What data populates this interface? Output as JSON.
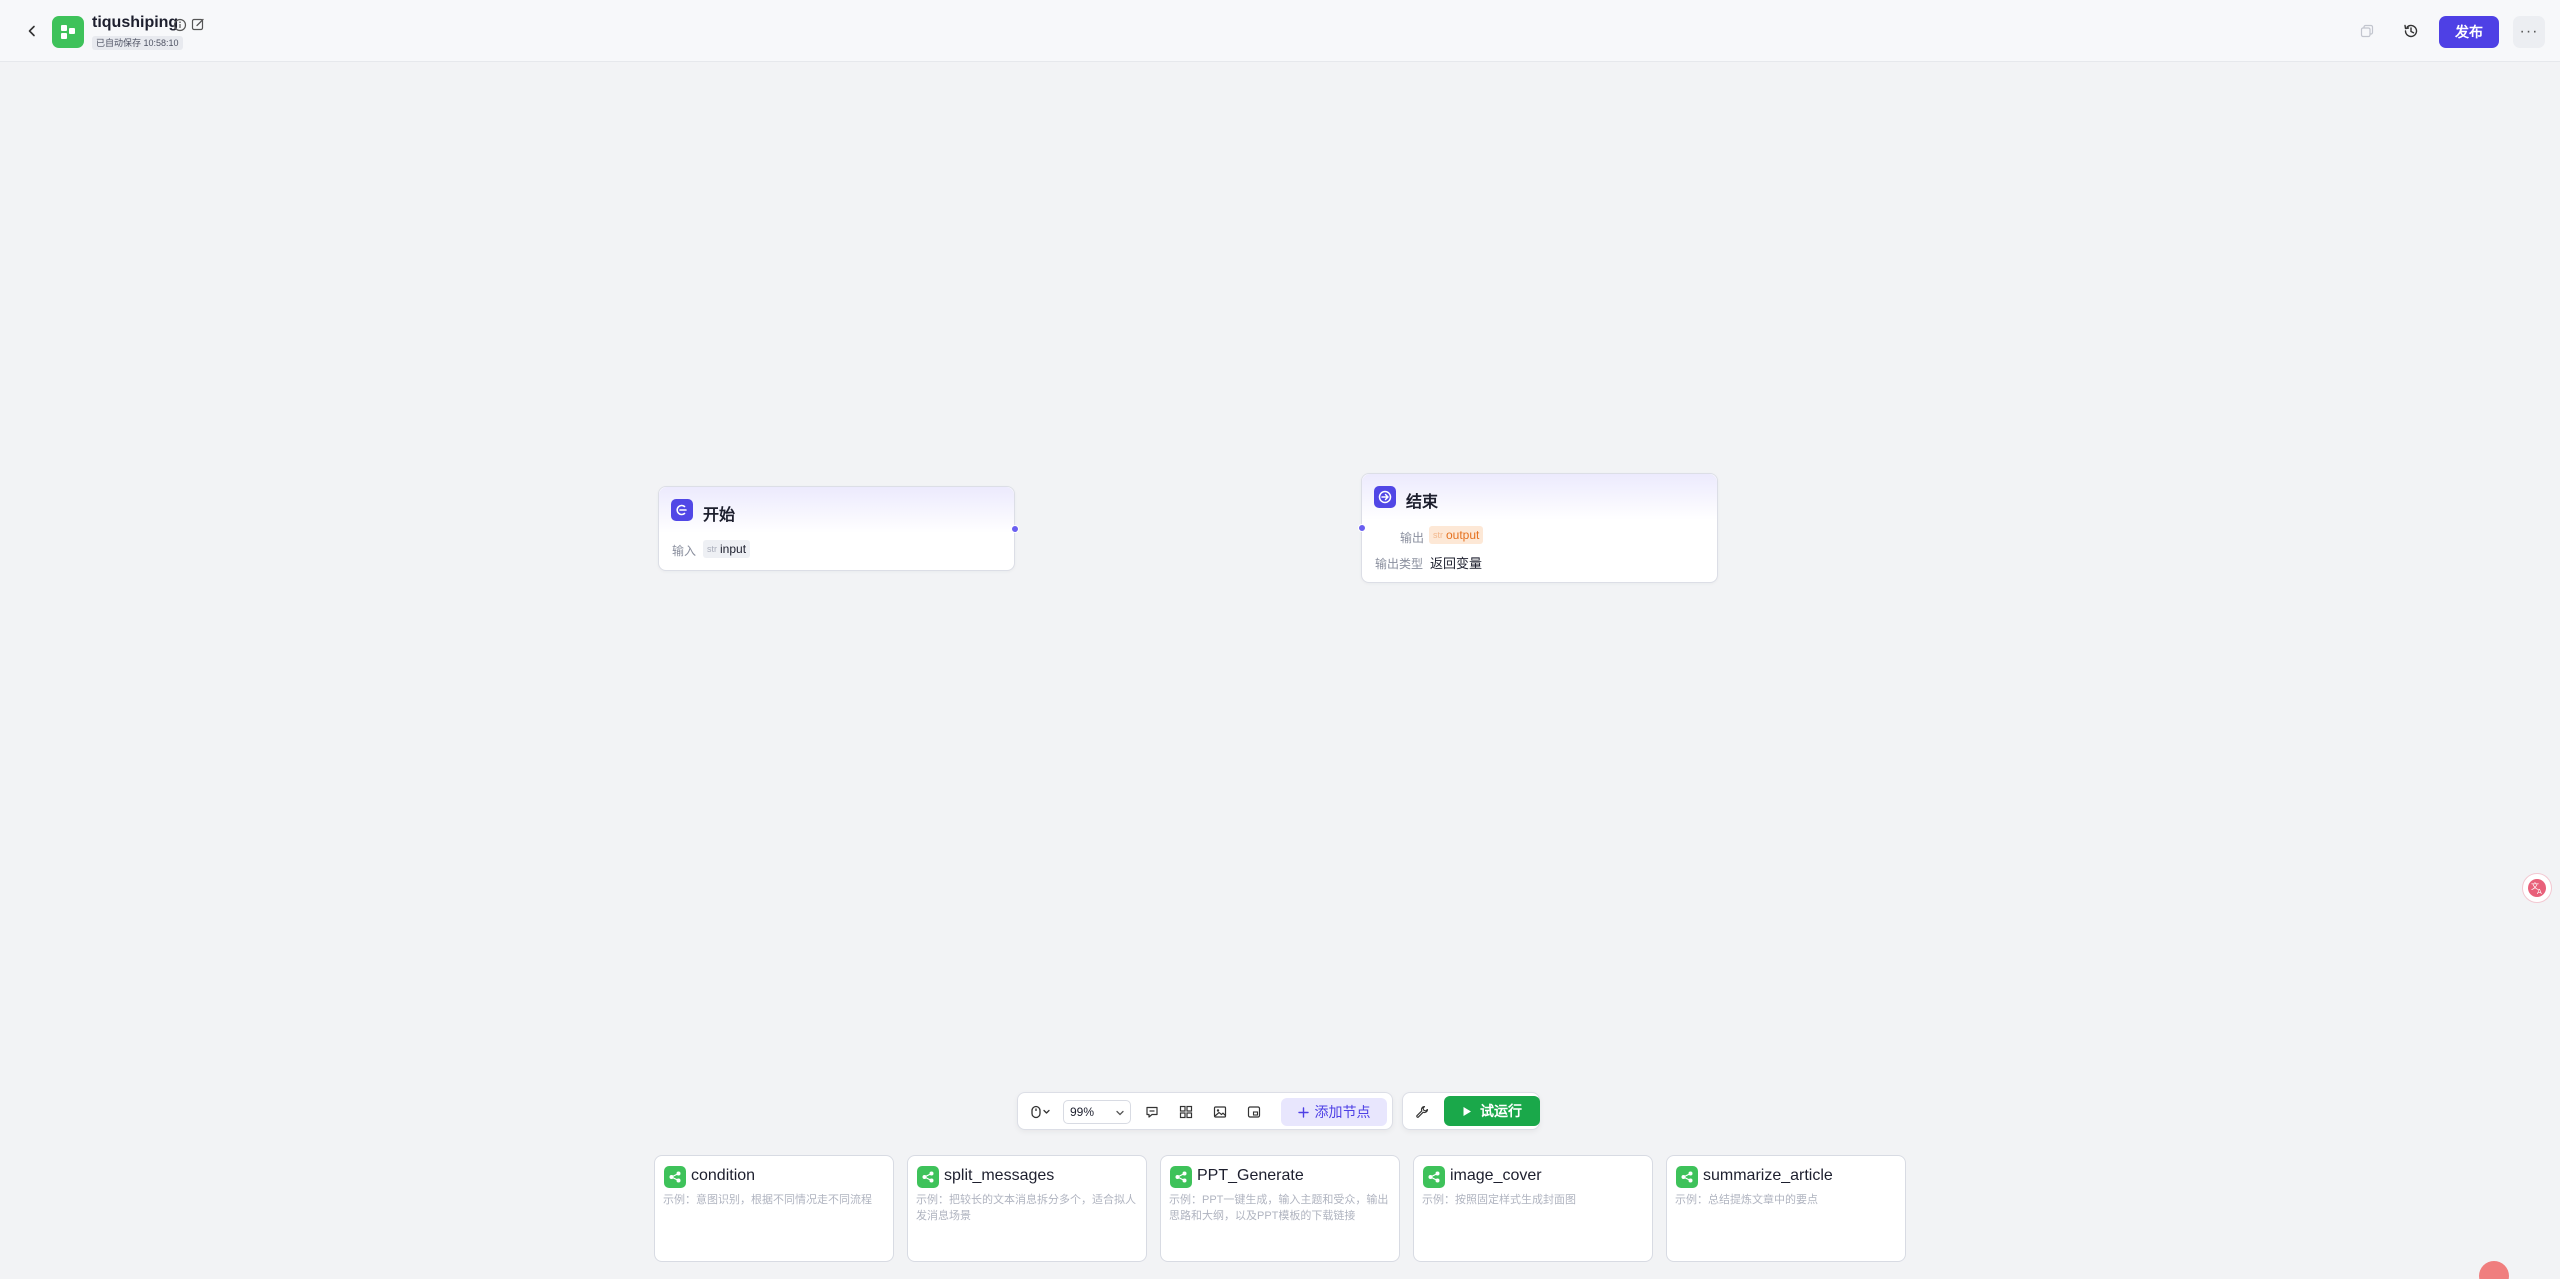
{
  "header": {
    "app_name": "tiqushiping",
    "save_status": "已自动保存 10:58:10",
    "publish_label": "发布",
    "more_label": "···"
  },
  "nodes": {
    "start": {
      "title": "开始",
      "input_label": "输入",
      "input_type": "str",
      "input_name": "input"
    },
    "end": {
      "title": "结束",
      "output_label": "输出",
      "output_type": "str",
      "output_name": "output",
      "output_type_label": "输出类型",
      "output_type_value": "返回变量"
    }
  },
  "toolbar": {
    "zoom": "99%",
    "add_node_label": "添加节点",
    "run_label": "试运行"
  },
  "templates": [
    {
      "name": "condition",
      "desc": "示例：意图识别，根据不同情况走不同流程"
    },
    {
      "name": "split_messages",
      "desc": "示例：把较长的文本消息拆分多个，适合拟人发消息场景"
    },
    {
      "name": "PPT_Generate",
      "desc": "示例：PPT一键生成，输入主题和受众，输出思路和大纲，以及PPT模板的下载链接"
    },
    {
      "name": "image_cover",
      "desc": "示例：按照固定样式生成封面图"
    },
    {
      "name": "summarize_article",
      "desc": "示例：总结提炼文章中的要点"
    }
  ],
  "colors": {
    "accent": "#4e40e5",
    "run_green": "#1aa84a",
    "app_logo_green": "#3ec25a"
  },
  "icons": [
    "back-icon",
    "info-icon",
    "edit-icon",
    "copy-icon",
    "history-icon",
    "more-icon",
    "mouse-icon",
    "comment-icon",
    "minimap-icon",
    "image-icon",
    "fit-view-icon",
    "plus-icon",
    "wrench-icon",
    "play-icon",
    "translate-icon"
  ]
}
